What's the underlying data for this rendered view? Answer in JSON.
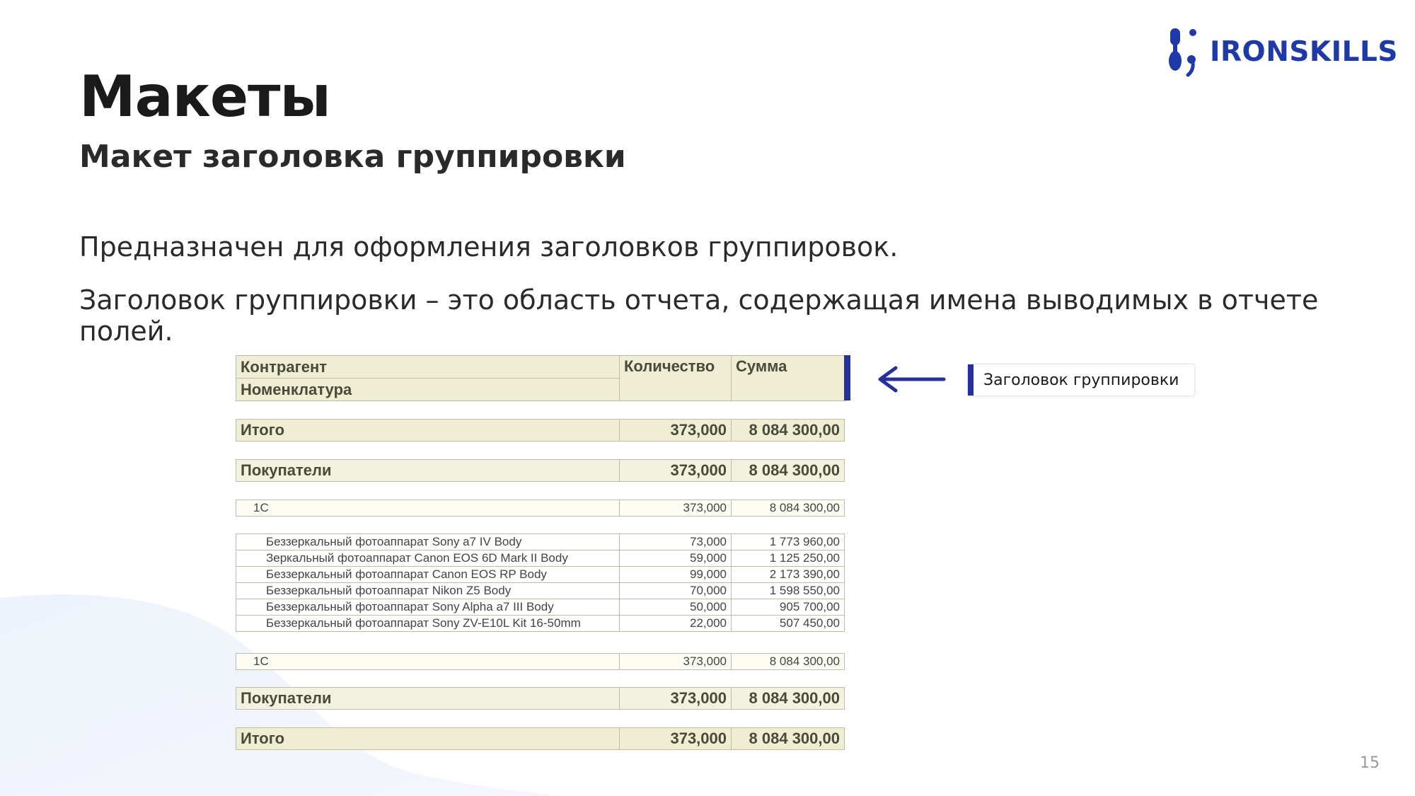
{
  "brand": {
    "name": "IRONSKILLS",
    "color": "#1e3aa8"
  },
  "slide": {
    "title": "Макеты",
    "subtitle": "Макет заголовка группировки",
    "paragraph1": "Предназначен для оформления заголовков группировок.",
    "paragraph2": "Заголовок группировки – это область отчета, содержащая имена выводимых в отчете полей.",
    "page_number": "15"
  },
  "report": {
    "header": {
      "col1_line1": "Контрагент",
      "col1_line2": "Номенклатура",
      "col2": "Количество",
      "col3": "Сумма"
    },
    "total_top": {
      "label": "Итого",
      "qty": "373,000",
      "sum": "8 084 300,00"
    },
    "group_top": {
      "label": "Покупатели",
      "qty": "373,000",
      "sum": "8 084 300,00"
    },
    "sub_top": {
      "label": "1С",
      "qty": "373,000",
      "sum": "8 084 300,00"
    },
    "details": [
      {
        "name": "Беззеркальный фотоаппарат Sony a7 IV Body",
        "qty": "73,000",
        "sum": "1 773 960,00"
      },
      {
        "name": "Зеркальный фотоаппарат Canon EOS 6D Mark II Body",
        "qty": "59,000",
        "sum": "1 125 250,00"
      },
      {
        "name": "Беззеркальный фотоаппарат Canon EOS RP Body",
        "qty": "99,000",
        "sum": "2 173 390,00"
      },
      {
        "name": "Беззеркальный фотоаппарат Nikon Z5 Body",
        "qty": "70,000",
        "sum": "1 598 550,00"
      },
      {
        "name": "Беззеркальный фотоаппарат Sony Alpha a7 III Body",
        "qty": "50,000",
        "sum": "905 700,00"
      },
      {
        "name": "Беззеркальный фотоаппарат Sony ZV-E10L Kit 16-50mm",
        "qty": "22,000",
        "sum": "507 450,00"
      }
    ],
    "sub_bottom": {
      "label": "1С",
      "qty": "373,000",
      "sum": "8 084 300,00"
    },
    "group_bottom": {
      "label": "Покупатели",
      "qty": "373,000",
      "sum": "8 084 300,00"
    },
    "total_bottom": {
      "label": "Итого",
      "qty": "373,000",
      "sum": "8 084 300,00"
    }
  },
  "callout": {
    "label": "Заголовок группировки",
    "accent": "#26309e"
  }
}
